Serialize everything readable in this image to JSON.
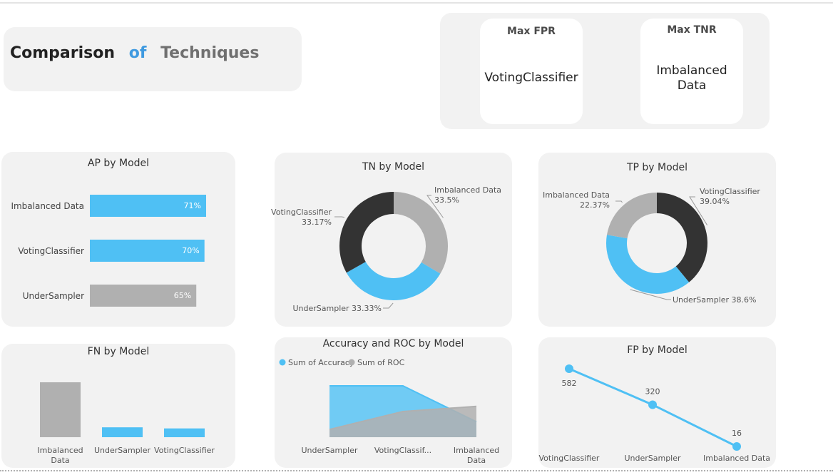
{
  "page": {
    "title_parts": [
      "Comparison",
      "of",
      "Techniques"
    ],
    "colors": {
      "blue": "#4fc0f4",
      "gray": "#b0b0b0",
      "dark": "#333333",
      "title_of": "#3f9ae0",
      "title_tech": "#707070"
    }
  },
  "cards": [
    {
      "label": "Max FPR",
      "value": "VotingClassifier"
    },
    {
      "label": "Max TNR",
      "value": "Imbalanced Data"
    }
  ],
  "chart_data": [
    {
      "id": "ap",
      "type": "bar",
      "orientation": "horizontal",
      "title": "AP by Model",
      "categories": [
        "Imbalanced Data",
        "VotingClassifier",
        "UnderSampler"
      ],
      "values": [
        71,
        70,
        65
      ],
      "value_labels": [
        "71%",
        "70%",
        "65%"
      ],
      "colors": [
        "#4fc0f4",
        "#4fc0f4",
        "#b0b0b0"
      ]
    },
    {
      "id": "tn",
      "type": "pie",
      "donut": true,
      "title": "TN by Model",
      "labels": [
        "Imbalanced Data",
        "UnderSampler",
        "VotingClassifier"
      ],
      "values": [
        33.5,
        33.33,
        33.17
      ],
      "value_labels": [
        "33.5%",
        "33.33%",
        "33.17%"
      ],
      "colors": [
        "#b0b0b0",
        "#4fc0f4",
        "#333333"
      ]
    },
    {
      "id": "tp",
      "type": "pie",
      "donut": true,
      "title": "TP by Model",
      "labels": [
        "VotingClassifier",
        "UnderSampler",
        "Imbalanced Data"
      ],
      "values": [
        39.04,
        38.6,
        22.37
      ],
      "value_labels": [
        "39.04%",
        "38.6%",
        "22.37%"
      ],
      "colors": [
        "#333333",
        "#4fc0f4",
        "#b0b0b0"
      ]
    },
    {
      "id": "fn",
      "type": "bar",
      "title": "FN by Model",
      "categories": [
        "Imbalanced Data",
        "UnderSampler",
        "VotingClassifier"
      ],
      "values": [
        100,
        18,
        16
      ],
      "colors": [
        "#b0b0b0",
        "#4fc0f4",
        "#4fc0f4"
      ]
    },
    {
      "id": "acc",
      "type": "area",
      "title": "Accuracy and ROC by Model",
      "categories": [
        "UnderSampler",
        "VotingClassif...",
        "Imbalanced Data"
      ],
      "series": [
        {
          "name": "Sum of Accuracy",
          "values": [
            1.0,
            1.0,
            0.3
          ],
          "color": "#4fc0f4"
        },
        {
          "name": "Sum of ROC",
          "values": [
            0.15,
            0.5,
            0.6
          ],
          "color": "#b0b0b0"
        }
      ],
      "legend": "top-left"
    },
    {
      "id": "fp",
      "type": "line",
      "title": "FP by Model",
      "categories": [
        "VotingClassifier",
        "UnderSampler",
        "Imbalanced Data"
      ],
      "values": [
        582,
        320,
        16
      ],
      "color": "#4fc0f4"
    }
  ]
}
